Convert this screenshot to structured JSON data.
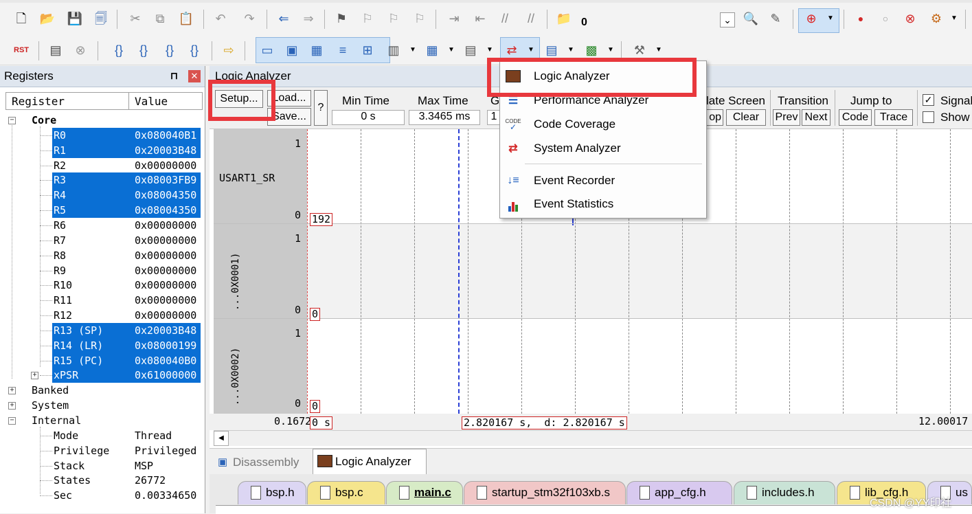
{
  "toolbar1": {
    "build_count": "0"
  },
  "registers": {
    "title": "Registers",
    "pin": "❑",
    "col_register": "Register",
    "col_value": "Value",
    "core_label": "Core",
    "rows": [
      {
        "name": "R0",
        "value": "0x080040B1"
      },
      {
        "name": "R1",
        "value": "0x20003B48"
      },
      {
        "name": "R2",
        "value": "0x00000000"
      },
      {
        "name": "R3",
        "value": "0x08003FB9"
      },
      {
        "name": "R4",
        "value": "0x08004350"
      },
      {
        "name": "R5",
        "value": "0x08004350"
      },
      {
        "name": "R6",
        "value": "0x00000000"
      },
      {
        "name": "R7",
        "value": "0x00000000"
      },
      {
        "name": "R8",
        "value": "0x00000000"
      },
      {
        "name": "R9",
        "value": "0x00000000"
      },
      {
        "name": "R10",
        "value": "0x00000000"
      },
      {
        "name": "R11",
        "value": "0x00000000"
      },
      {
        "name": "R12",
        "value": "0x00000000"
      },
      {
        "name": "R13 (SP)",
        "value": "0x20003B48"
      },
      {
        "name": "R14 (LR)",
        "value": "0x08000199"
      },
      {
        "name": "R15 (PC)",
        "value": "0x080040B0"
      },
      {
        "name": "xPSR",
        "value": "0x61000000"
      }
    ],
    "banked": "Banked",
    "system": "System",
    "internal": "Internal",
    "internal_rows": [
      {
        "name": "Mode",
        "value": "Thread"
      },
      {
        "name": "Privilege",
        "value": "Privileged"
      },
      {
        "name": "Stack",
        "value": "MSP"
      },
      {
        "name": "States",
        "value": "26772"
      },
      {
        "name": "Sec",
        "value": "0.00334650"
      }
    ]
  },
  "logic": {
    "title": "Logic Analyzer",
    "setup": "Setup...",
    "load": "Load...",
    "save": "Save...",
    "help": "?",
    "min_time_label": "Min Time",
    "min_time": "0 s",
    "max_time_label": "Max Time",
    "max_time": "3.3465 ms",
    "grid_label": "G",
    "grid_value": "1",
    "update_label": "late Screen",
    "stop": "op",
    "clear": "Clear",
    "transition_label": "Transition",
    "prev": "Prev",
    "next": "Next",
    "jump_label": "Jump to",
    "code": "Code",
    "trace": "Trace",
    "signal_label": "Signal",
    "show_label": "Show",
    "signals": [
      {
        "name": "USART1_SR",
        "hi": "1",
        "lo": "0",
        "val": "192"
      },
      {
        "name": "...0X0001)",
        "hi": "1",
        "lo": "0",
        "val": "0"
      },
      {
        "name": "...0X0002)",
        "hi": "1",
        "lo": "0",
        "val": "0"
      }
    ],
    "time_left": "0.1672",
    "cursor_left": "0 s",
    "cursor_mid": "2.820167 s,  d: 2.820167 s",
    "time_right": "12.00017",
    "scroll_left": "◀"
  },
  "menu": {
    "items": [
      {
        "label": "Logic Analyzer",
        "icon": "logic-analyzer-icon"
      },
      {
        "label": "Performance Analyzer",
        "icon": "performance-analyzer-icon"
      },
      {
        "label": "Code Coverage",
        "icon": "code-coverage-icon"
      },
      {
        "label": "System Analyzer",
        "icon": "system-analyzer-icon"
      },
      {
        "label": "Event Recorder",
        "icon": "event-recorder-icon"
      },
      {
        "label": "Event Statistics",
        "icon": "event-statistics-icon"
      }
    ]
  },
  "bottom_tabs": [
    {
      "label": "Disassembly"
    },
    {
      "label": "Logic Analyzer"
    }
  ],
  "doc_tabs": [
    {
      "label": "bsp.h",
      "color": "#dcd6f3"
    },
    {
      "label": "bsp.c",
      "color": "#f5e58d"
    },
    {
      "label": "main.c",
      "color": "#d7ebc6"
    },
    {
      "label": "startup_stm32f103xb.s",
      "color": "#f1c7c7"
    },
    {
      "label": "app_cfg.h",
      "color": "#d8c9ef"
    },
    {
      "label": "includes.h",
      "color": "#c9e3d6"
    },
    {
      "label": "lib_cfg.h",
      "color": "#f5e58d"
    },
    {
      "label": "us",
      "color": "#dcd6f3"
    }
  ],
  "watermark": "CSDN @YY印社"
}
